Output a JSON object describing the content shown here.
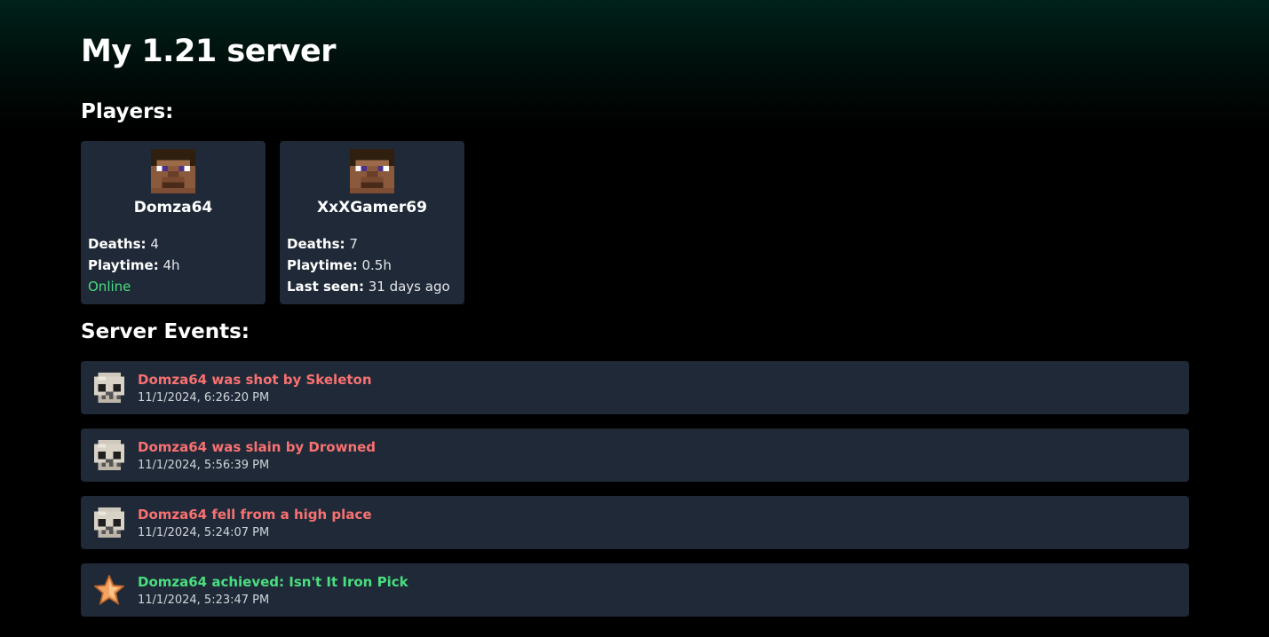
{
  "server": {
    "title": "My 1.21 server"
  },
  "players_section": {
    "heading": "Players:"
  },
  "players": [
    {
      "name": "Domza64",
      "avatar_icon": "steve-head-icon",
      "deaths_label": "Deaths:",
      "deaths": "4",
      "playtime_label": "Playtime:",
      "playtime": "4h",
      "status": "Online"
    },
    {
      "name": "XxXGamer69",
      "avatar_icon": "steve-head-icon",
      "deaths_label": "Deaths:",
      "deaths": "7",
      "playtime_label": "Playtime:",
      "playtime": "0.5h",
      "last_seen_label": "Last seen:",
      "last_seen": "31 days ago"
    }
  ],
  "events_section": {
    "heading": "Server Events:"
  },
  "events": [
    {
      "type": "death",
      "icon": "skull-icon",
      "message": "Domza64 was shot by Skeleton",
      "time": "11/1/2024, 6:26:20 PM"
    },
    {
      "type": "death",
      "icon": "skull-icon",
      "message": "Domza64 was slain by Drowned",
      "time": "11/1/2024, 5:56:39 PM"
    },
    {
      "type": "death",
      "icon": "skull-icon",
      "message": "Domza64 fell from a high place",
      "time": "11/1/2024, 5:24:07 PM"
    },
    {
      "type": "achievement",
      "icon": "star-icon",
      "message": "Domza64 achieved: Isn't It Iron Pick",
      "time": "11/1/2024, 5:23:47 PM"
    }
  ],
  "colors": {
    "card_background": "#1f2937",
    "death_text": "#f87171",
    "achievement_text": "#4ade80",
    "online_text": "#4ade80"
  }
}
